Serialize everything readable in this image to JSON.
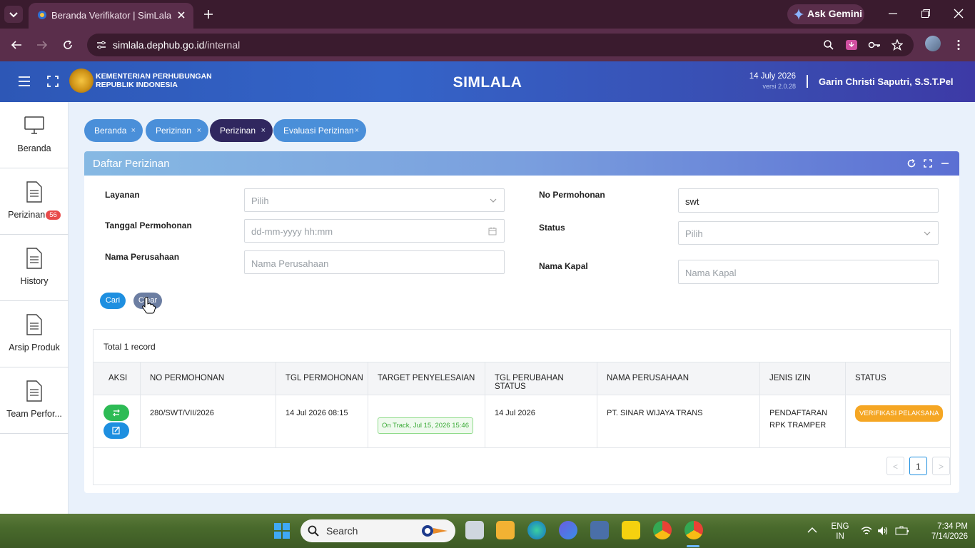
{
  "browser": {
    "tab_title": "Beranda Verifikator | SimLala",
    "gemini_label": "Ask Gemini",
    "url_domain": "simlala.dephub.go.id",
    "url_path": "/internal"
  },
  "header": {
    "org_line1": "KEMENTERIAN PERHUBUNGAN",
    "org_line2": "REPUBLIK INDONESIA",
    "app_title": "SIMLALA",
    "date": "14 July 2026",
    "version": "versi 2.0.28",
    "user_name": "Garin Christi Saputri, S.S.T.Pel"
  },
  "sidebar": {
    "items": [
      {
        "label": "Beranda",
        "icon": "monitor-icon"
      },
      {
        "label": "Perizinan",
        "icon": "document-icon",
        "badge": "56"
      },
      {
        "label": "History",
        "icon": "document-icon"
      },
      {
        "label": "Arsip Produk",
        "icon": "document-icon"
      },
      {
        "label": "Team Perfor...",
        "icon": "document-icon"
      }
    ]
  },
  "tabs": [
    {
      "label": "Beranda",
      "close": "×"
    },
    {
      "label": "Perizinan",
      "close": "×"
    },
    {
      "label": "Perizinan",
      "close": "×",
      "active": true
    },
    {
      "label": "Evaluasi Perizinan",
      "close": "×"
    }
  ],
  "panel": {
    "title": "Daftar Perizinan",
    "filters": {
      "layanan_label": "Layanan",
      "layanan_placeholder": "Pilih",
      "tanggal_label": "Tanggal Permohonan",
      "tanggal_placeholder": "dd-mm-yyyy hh:mm",
      "perusahaan_label": "Nama Perusahaan",
      "perusahaan_placeholder": "Nama Perusahaan",
      "no_label": "No Permohonan",
      "no_value": "swt",
      "status_label": "Status",
      "status_placeholder": "Pilih",
      "kapal_label": "Nama Kapal",
      "kapal_placeholder": "Nama Kapal"
    },
    "cari_label": "Cari",
    "clear_label": "Clear"
  },
  "table": {
    "total_text": "Total 1 record",
    "columns": [
      "AKSI",
      "NO PERMOHONAN",
      "TGL PERMOHONAN",
      "TARGET PENYELESAIAN",
      "TGL PERUBAHAN STATUS",
      "NAMA PERUSAHAAN",
      "JENIS IZIN",
      "STATUS"
    ],
    "rows": [
      {
        "no_permohonan": "280/SWT/VII/2026",
        "tgl_permohonan": "14 Jul 2026 08:15",
        "target": "On Track, Jul 15, 2026 15:46",
        "tgl_perubahan": "14 Jul 2026",
        "nama_perusahaan": "PT. SINAR WIJAYA TRANS",
        "jenis_izin_1": "PENDAFTARAN",
        "jenis_izin_2": "RPK TRAMPER",
        "status": "VERIFIKASI PELAKSANA"
      }
    ],
    "pagination": {
      "prev": "<",
      "current": "1",
      "next": ">"
    }
  },
  "taskbar": {
    "search_label": "Search",
    "lang_1": "ENG",
    "lang_2": "IN",
    "time": "7:34 PM",
    "date": "7/14/2026"
  },
  "colors": {
    "accent": "#1e8fe0",
    "header_blue": "#3464c8",
    "active_tab": "#30275f",
    "status_orange": "#f5a623",
    "ontrack_green": "#3aaa36"
  }
}
